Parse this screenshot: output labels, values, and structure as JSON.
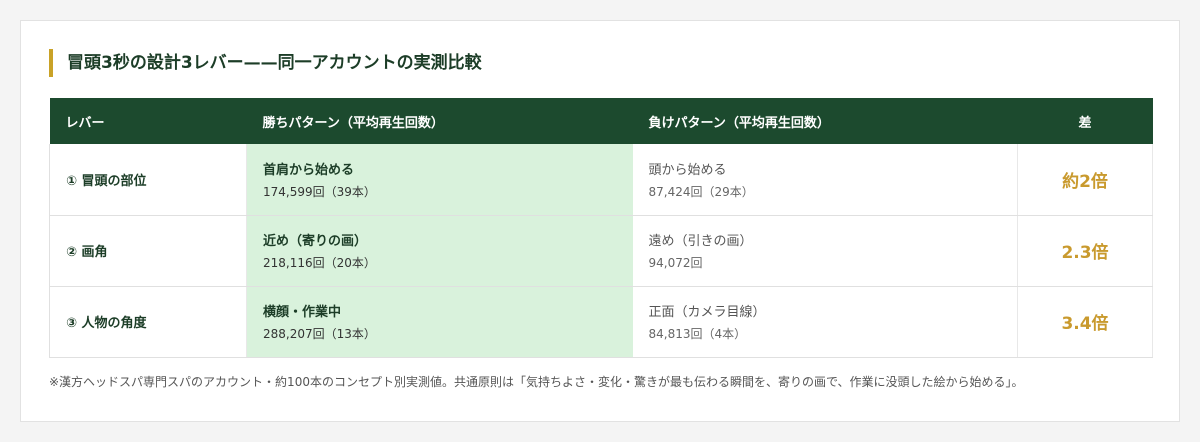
{
  "title": "冒頭3秒の設計3レバー——同一アカウントの実測比較",
  "table": {
    "headers": [
      "レバー",
      "勝ちパターン（平均再生回数）",
      "負けパターン（平均再生回数）",
      "差"
    ],
    "rows": [
      {
        "lever": "① 冒頭の部位",
        "win_main": "首肩から始める",
        "win_sub": "174,599回（39本）",
        "lose_main": "頭から始める",
        "lose_sub": "87,424回（29本）",
        "diff": "約2倍"
      },
      {
        "lever": "② 画角",
        "win_main": "近め（寄りの画）",
        "win_sub": "218,116回（20本）",
        "lose_main": "遠め（引きの画）",
        "lose_sub": "94,072回",
        "diff": "2.3倍"
      },
      {
        "lever": "③ 人物の角度",
        "win_main": "横顔・作業中",
        "win_sub": "288,207回（13本）",
        "lose_main": "正面（カメラ目線）",
        "lose_sub": "84,813回（4本）",
        "diff": "3.4倍"
      }
    ]
  },
  "note": "※漢方ヘッドスパ専門スパのアカウント・約100本のコンセプト別実測値。共通原則は「気持ちよさ・変化・驚きが最も伝わる瞬間を、寄りの画で、作業に没頭した絵から始める」。",
  "colors": {
    "header_bg": "#1c4a2e",
    "accent": "#c9a227",
    "win_bg": "#d9f2dc",
    "diff_text": "#c99a2e"
  }
}
